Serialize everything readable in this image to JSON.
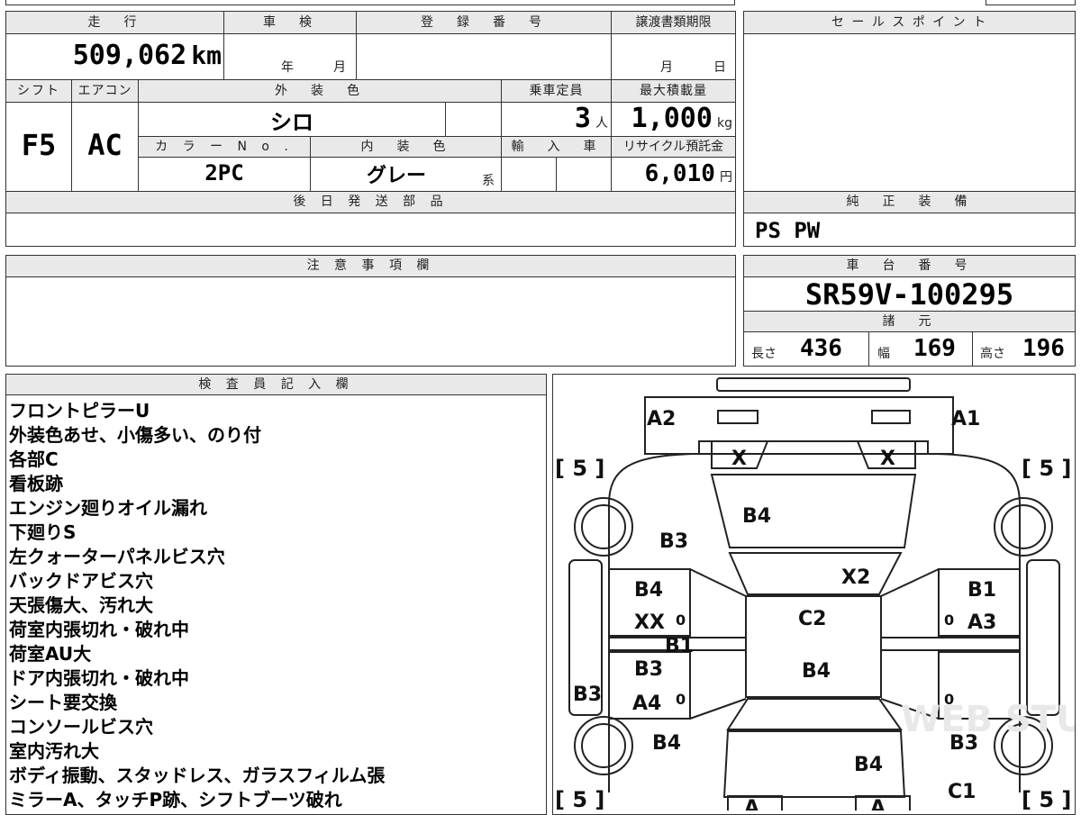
{
  "sheet": {
    "labels": {
      "mileage": "走　行",
      "inspection": "車　検",
      "registration": "登　録　番　号",
      "transfer_deadline": "譲渡書類期限",
      "sales_point": "セ ー ル ス ポ イ ン ト",
      "shift": "シフト",
      "aircon": "エアコン",
      "exterior_color": "外　装　色",
      "capacity": "乗車定員",
      "max_load": "最大積載量",
      "color_no": "カ ラ ー N o .",
      "interior_color": "内　装　色",
      "import": "輸　入　車",
      "recycle": "リサイクル預託金",
      "later_parts": "後 日 発 送 部 品",
      "genuine_equipment": "純　正　装　備",
      "cautions": "注 意 事 項 欄",
      "chassis_no": "車　台　番　号",
      "specs": "諸　元",
      "inspector_notes": "検 査 員 記 入 欄"
    },
    "mileage": {
      "value": "509,062",
      "unit": "km"
    },
    "inspection": {
      "year_unit": "年",
      "month_unit": "月"
    },
    "transfer": {
      "month_unit": "月",
      "day_unit": "日"
    },
    "shift": "F5",
    "aircon": "AC",
    "exterior_color": "シロ",
    "capacity": {
      "value": "3",
      "unit": "人"
    },
    "max_load": {
      "value": "1,000",
      "unit": "kg"
    },
    "color_no": "2PC",
    "interior_color": {
      "value": "グレー",
      "suffix": "系"
    },
    "recycle": {
      "value": "6,010",
      "unit": "円"
    },
    "genuine_equipment": "PS PW",
    "chassis_no": "SR59V-100295",
    "dims": {
      "length_label": "長さ",
      "length": "436",
      "width_label": "幅",
      "width": "169",
      "height_label": "高さ",
      "height": "196"
    },
    "notes": [
      "フロントピラーU",
      "外装色あせ、小傷多い、のり付",
      "各部C",
      "看板跡",
      "エンジン廻りオイル漏れ",
      "下廻りS",
      "左クォーターパネルビス穴",
      "バックドアビス穴",
      "天張傷大、汚れ大",
      "荷室内張切れ・破れ中",
      "荷室AU大",
      "ドア内張切れ・破れ中",
      "シート要交換",
      "コンソールビス穴",
      "室内汚れ大",
      "ボディ振動、スタッドレス、ガラスフィルム張",
      "ミラーA、タッチP跡、シフトブーツ破れ"
    ]
  },
  "diagram": {
    "tires": {
      "fl": "[ 5 ]",
      "fr": "[ 5 ]",
      "rl": "[ 5 ]",
      "rr": "[ 5 ]"
    },
    "marks": {
      "a2": "A2",
      "a1": "A1",
      "x_left": "X",
      "x_right": "X",
      "b4_hood": "B4",
      "b3_left_fender": "B3",
      "x2": "X2",
      "b4_left_front_door": "B4",
      "xx_left": "XX",
      "b1_left": "B1",
      "c2_roof": "C2",
      "b1_right": "B1",
      "a3": "A3",
      "b3_left_rear_door": "B3",
      "a4": "A4",
      "b4_roof_rear": "B4",
      "b3_left_side": "B3",
      "b4_left_rear": "B4",
      "b4_back": "B4",
      "b3_right_rear": "B3",
      "c1": "C1",
      "zero_1": "0",
      "zero_2": "0",
      "zero_3": "0",
      "zero_4": "0",
      "a_left_lamp": "A",
      "a_right_lamp": "A"
    },
    "watermark": "WEB STUDIO"
  }
}
